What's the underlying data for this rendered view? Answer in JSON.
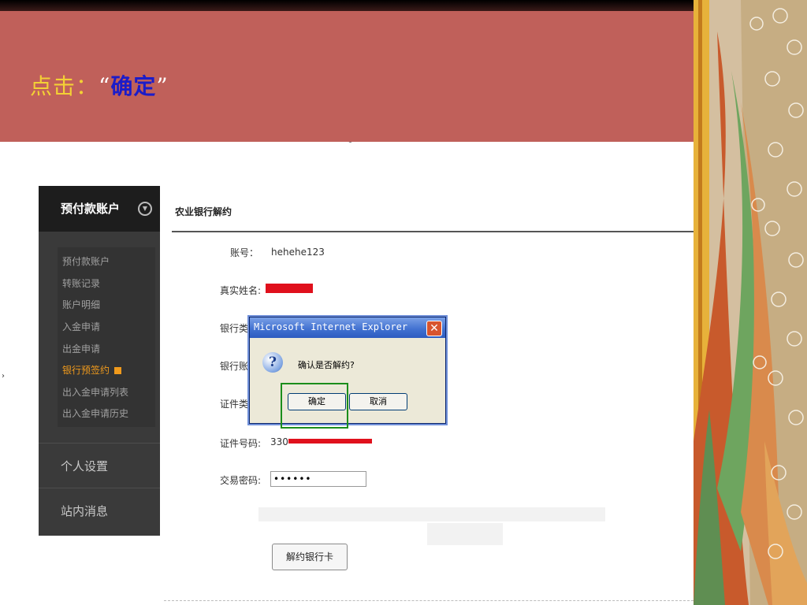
{
  "slide": {
    "title_prefix": "点击：",
    "title_quote_open": "“",
    "title_emphasis": "确定",
    "title_quote_close": "”",
    "header_color": "#c0605a",
    "prefix_color": "#f3d035",
    "emphasis_color": "#1c1cc8"
  },
  "sidebar": {
    "account_header": "预付款账户",
    "chevron_icon": "chevron-down-circle-icon",
    "items": [
      {
        "label": "预付款账户"
      },
      {
        "label": "转账记录"
      },
      {
        "label": "账户明细"
      },
      {
        "label": "入金申请"
      },
      {
        "label": "出金申请"
      },
      {
        "label": "银行预签约",
        "active": true
      },
      {
        "label": "出入金申请列表"
      },
      {
        "label": "出入金申请历史"
      }
    ],
    "personal_settings": "个人设置",
    "site_messages": "站内消息",
    "active_color": "#f09a1c"
  },
  "form": {
    "page_title": "农业银行解约",
    "account_label": "账号：",
    "account_value": "hehehe123",
    "real_name_label": "真实姓名:",
    "bank_type_label": "银行类",
    "bank_account_label": "银行账",
    "id_type_label": "证件类",
    "id_number_label": "证件号码:",
    "id_number_prefix": "330",
    "trade_password_label": "交易密码:",
    "trade_password_value": "••••••",
    "unbind_button": "解约银行卡",
    "redaction_color": "#e0101c"
  },
  "dialog": {
    "title": "Microsoft Internet Explorer",
    "close_icon": "close-icon",
    "question_icon": "question-icon",
    "message": "确认是否解约?",
    "ok_label": "确定",
    "cancel_label": "取消",
    "highlight_color": "#1b8e1b"
  }
}
